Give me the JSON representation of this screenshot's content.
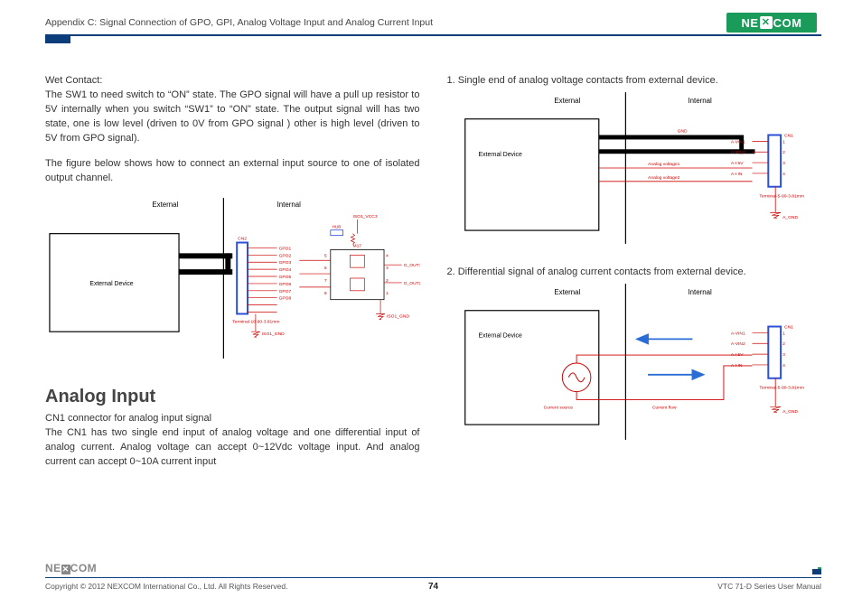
{
  "header": {
    "title": "Appendix C: Signal Connection of GPO, GPI, Analog Voltage Input and Analog Current Input",
    "brand": "NEXCOM"
  },
  "left": {
    "wet_title": "Wet Contact:",
    "wet_p1": "The SW1 to need switch to “ON” state. The GPO signal will have a pull up resistor to 5V internally when you switch “SW1” to “ON” state. The output signal will has two state, one is low level (driven to 0V from GPO signal ) other is high level (driven to 5V from GPO signal).",
    "wet_p2": "The figure below shows how to connect an external input source to one of isolated output channel.",
    "analog_title": "Analog Input",
    "analog_sub": "CN1 connector for analog input signal",
    "analog_p": "The CN1 has two single end input of analog voltage and one differential input of analog current. Analog voltage can accept 0~12Vdc voltage input. And analog current can accept 0~10A current input",
    "d1": {
      "external": "External",
      "internal": "Internal",
      "ext_device": "External Device",
      "conn": "CN2",
      "terminal": "Terminal-10-90-3.81mm",
      "iso_gnd": "ISO1_GND",
      "iso_vcc": "ISO1_VCC3",
      "hub": "HUB",
      "chip": "M17",
      "out1": "G_OUT1",
      "out2": "G_OUT2",
      "labels": [
        "GPO1",
        "GPO2",
        "GPO3",
        "GPO4",
        "GPO5",
        "GPO6",
        "GPO7",
        "GPO8"
      ],
      "pin_r": [
        "4",
        "3",
        "2",
        "1"
      ],
      "pin_l": [
        "5",
        "6",
        "7",
        "8"
      ]
    }
  },
  "right": {
    "item1": "1. Single end of analog voltage contacts from external device.",
    "item2": "2. Differential signal of analog current contacts from external device.",
    "d2": {
      "external": "External",
      "internal": "Internal",
      "ext_device": "External Device",
      "gnd": "GND",
      "av1": "Analog voltage1",
      "av2": "Analog voltage2",
      "conn": "CN1",
      "terminal": "Terminal-5-90-3.81mm",
      "a_gnd": "A_GND",
      "pins": [
        "A-VIN1",
        "A-VIN2",
        "A-I 5V",
        "A-I IN"
      ],
      "pin_nums": [
        "1",
        "2",
        "3",
        "4"
      ]
    },
    "d3": {
      "external": "External",
      "internal": "Internal",
      "ext_device": "External Device",
      "cur_src": "Current source",
      "cur_flow": "Current flow",
      "conn": "CN1",
      "terminal": "Terminal-5-90-3.81mm",
      "a_gnd": "A_GND",
      "pins": [
        "A-VIN1",
        "A-VIN2",
        "A-I 5V",
        "A-I IN"
      ],
      "pin_nums": [
        "1",
        "2",
        "3",
        "4"
      ]
    }
  },
  "footer": {
    "copyright": "Copyright © 2012 NEXCOM International Co., Ltd. All Rights Reserved.",
    "page": "74",
    "manual": "VTC 71-D Series User Manual",
    "brand": "NEXCOM"
  }
}
